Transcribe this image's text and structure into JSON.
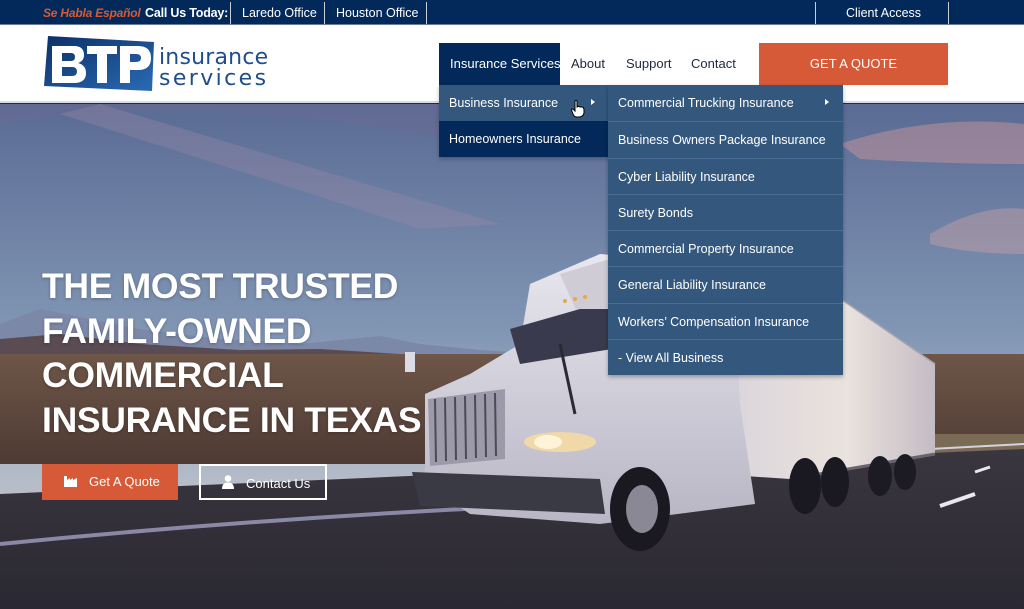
{
  "topbar": {
    "espanol": "Se Habla Español",
    "call_us": "Call Us Today:",
    "links": [
      "Laredo Office",
      "Houston Office"
    ],
    "client_access": "Client Access"
  },
  "logo": {
    "mark": "BTP",
    "line1": "insurance",
    "line2": "services"
  },
  "nav": {
    "items": [
      "Insurance Services",
      "About",
      "Support",
      "Contact"
    ],
    "active": "Insurance Services",
    "cta": "GET A QUOTE"
  },
  "dropdown": {
    "level1": [
      {
        "label": "Business Insurance",
        "has_submenu": true,
        "hovered": true
      },
      {
        "label": "Homeowners Insurance",
        "has_submenu": false
      }
    ],
    "level2": [
      {
        "label": "Commercial Trucking Insurance",
        "has_submenu": true
      },
      {
        "label": "Business Owners Package Insurance"
      },
      {
        "label": "Cyber Liability Insurance"
      },
      {
        "label": "Surety Bonds"
      },
      {
        "label": "Commercial Property Insurance"
      },
      {
        "label": "General Liability Insurance"
      },
      {
        "label": "Workers’ Compensation Insurance"
      },
      {
        "label": "- View All Business"
      }
    ]
  },
  "hero": {
    "headline": [
      "THE MOST TRUSTED",
      "FAMILY-OWNED",
      "COMMERCIAL",
      "INSURANCE IN TEXAS"
    ],
    "buttons": {
      "quote": {
        "label": "Get A Quote",
        "icon": "factory-icon"
      },
      "contact": {
        "label": "Contact Us",
        "icon": "user-icon"
      }
    },
    "image": "white semi truck on highway with mountains at dusk"
  },
  "colors": {
    "navy": "#03295a",
    "orange": "#d65a37",
    "menu_blue": "#34587d",
    "logo_blue": "#1f4e8c"
  }
}
